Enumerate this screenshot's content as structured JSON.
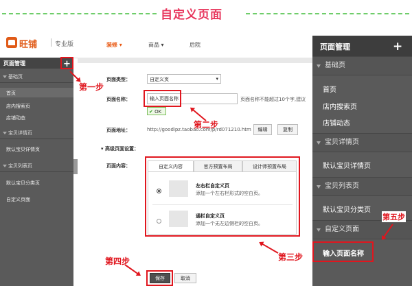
{
  "banner": {
    "title": "自定义页面"
  },
  "topnav": {
    "brand": "旺铺",
    "edition": "专业版",
    "items": [
      {
        "label": "装修",
        "active": true
      },
      {
        "label": "商品",
        "active": false
      },
      {
        "label": "后院",
        "active": false
      }
    ]
  },
  "sidebar": {
    "title": "页面管理",
    "add": "+",
    "sections": [
      {
        "label": "基础页",
        "items": [
          "首页",
          "店内搜索页",
          "店铺动态"
        ]
      },
      {
        "label": "宝贝详情页",
        "items": [
          "默认宝贝详情页"
        ]
      },
      {
        "label": "宝贝列表页",
        "items": [
          "默认宝贝分类页",
          "自定义页面"
        ]
      }
    ]
  },
  "form": {
    "type_label": "页面类型：",
    "type_value": "自定义页",
    "name_label": "页面名称：",
    "name_value": "输入页面名称",
    "name_hint": "页面名称不能超过10个字,建议",
    "ok": "OK",
    "addr_label": "页面地址：",
    "addr_value": "http://goodipz.taobao.com/p/rd071210.htm",
    "edit_btn": "编辑",
    "copy_btn": "复制",
    "adv_label": "高级页面设置：",
    "content_label": "页面内容：",
    "tabs": [
      "自定义内容",
      "官方预置布局",
      "设计师预置布局"
    ],
    "options": [
      {
        "title": "左右栏自定义页",
        "desc": "添加一个左右栏形式的空白页。",
        "checked": true
      },
      {
        "title": "通栏自定义页",
        "desc": "添加一个无左边侧栏的空白页。",
        "checked": false
      }
    ],
    "save_btn": "保存",
    "cancel_btn": "取消"
  },
  "steps": [
    "第一步",
    "第二步",
    "第三步",
    "第四步",
    "第五步"
  ],
  "right_panel": {
    "title": "页面管理",
    "add": "+",
    "sections": [
      {
        "label": "基础页",
        "items": [
          "首页",
          "店内搜索页",
          "店铺动态"
        ]
      },
      {
        "label": "宝贝详情页",
        "items": [
          "默认宝贝详情页"
        ]
      },
      {
        "label": "宝贝列表页",
        "items": [
          "默认宝贝分类页"
        ]
      },
      {
        "label": "自定义页面",
        "items": [
          "输入页面名称"
        ]
      }
    ]
  },
  "colors": {
    "accent": "#e0161e",
    "brand": "#e05a17",
    "title": "#e8365d"
  }
}
